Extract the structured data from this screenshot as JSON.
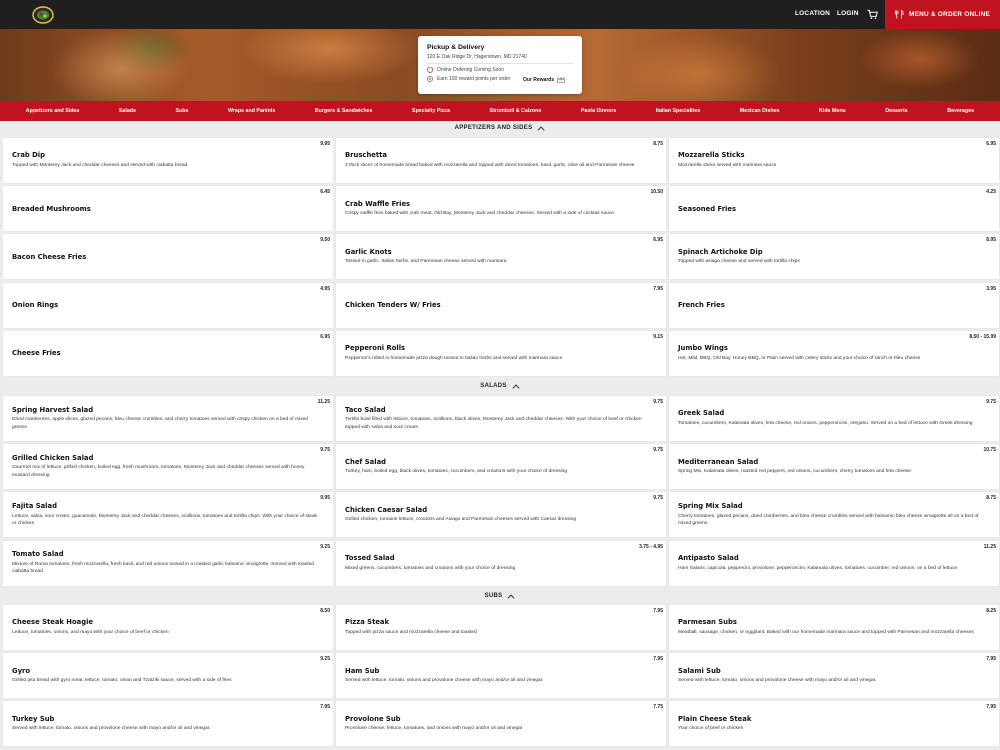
{
  "nav": {
    "location": "LOCATION",
    "login": "LOGIN",
    "order_button": "MENU & ORDER ONLINE"
  },
  "colors": {
    "brand_red": "#c1121f",
    "topbar": "#1f1f1f",
    "card_bg": "#ffffff",
    "page_bg": "#ececec"
  },
  "icons": [
    "logo",
    "cart-icon",
    "utensils-icon",
    "alert-icon",
    "rewards-icon",
    "crown-icon",
    "chevron-up-icon"
  ],
  "pickup": {
    "title": "Pickup & Delivery",
    "address": "120 E Oak Ridge Dr, Hagerstown, MD 21740",
    "notice": "Online Ordering Coming Soon",
    "points": "Earn 100 reward points per order",
    "rewards_link": "Our Rewards"
  },
  "categories": [
    "Appetizers and Sides",
    "Salads",
    "Subs",
    "Wraps and Paninis",
    "Burgers & Sandwiches",
    "Specialty Pizza",
    "Stromboli & Calzone",
    "Pasta Dinners",
    "Italian Specialties",
    "Mexican Dishes",
    "Kids Menu",
    "Desserts",
    "Beverages"
  ],
  "sections": [
    {
      "title": "APPETIZERS AND SIDES",
      "items": [
        {
          "name": "Crab Dip",
          "price": "9.95",
          "desc": "Topped with Monterey Jack and cheddar cheeses and served with ciabatta bread"
        },
        {
          "name": "Bruschetta",
          "price": "8.75",
          "desc": "3 thick slices of homemade bread baked with mozzarella and topped with diced tomatoes, basil, garlic, olive oil and Parmesan cheese"
        },
        {
          "name": "Mozzarella Sticks",
          "price": "6.95",
          "desc": "Mozzarella sticks served with marinara sauce"
        },
        {
          "name": "Breaded Mushrooms",
          "price": "6.45",
          "desc": ""
        },
        {
          "name": "Crab Waffle Fries",
          "price": "10.50",
          "desc": "Crispy waffle fries baked with crab meat, Old Bay, Monterey Jack and cheddar cheeses. Served with a side of cocktail sauce"
        },
        {
          "name": "Seasoned Fries",
          "price": "4.25",
          "desc": ""
        },
        {
          "name": "Bacon Cheese Fries",
          "price": "9.50",
          "desc": ""
        },
        {
          "name": "Garlic Knots",
          "price": "6.95",
          "desc": "Tossed in garlic, Italian herbs, and Parmesan cheese served with marinara"
        },
        {
          "name": "Spinach Artichoke Dip",
          "price": "8.95",
          "desc": "Topped with asiago cheese and served with tortilla chips"
        },
        {
          "name": "Onion Rings",
          "price": "4.95",
          "desc": ""
        },
        {
          "name": "Chicken Tenders W/ Fries",
          "price": "7.95",
          "desc": ""
        },
        {
          "name": "French Fries",
          "price": "3.95",
          "desc": ""
        },
        {
          "name": "Cheese Fries",
          "price": "6.95",
          "desc": ""
        },
        {
          "name": "Pepperoni Rolls",
          "price": "9.15",
          "desc": "Pepperoni's rolled in homemade pizza dough tossed in Italian herbs and served with marinara sauce"
        },
        {
          "name": "Jumbo Wings",
          "price": "8.50 - 15.99",
          "desc": "Hot, Mild, BBQ, Old Bay, Honey BBQ, or Plain served with celery sticks and your choice of ranch or bleu cheese"
        }
      ]
    },
    {
      "title": "SALADS",
      "items": [
        {
          "name": "Spring Harvest Salad",
          "price": "11.25",
          "desc": "Dried cranberries, apple slices, glazed pecans, bleu cheese crumbles, and cherry tomatoes served with crispy chicken on a bed of mixed greens"
        },
        {
          "name": "Taco Salad",
          "price": "9.75",
          "desc": "Tortilla bowl filled with lettuce, tomatoes, scallions, black olives, Monterey Jack and cheddar cheeses. With your choice of beef or chicken topped with salsa and sour cream"
        },
        {
          "name": "Greek Salad",
          "price": "9.75",
          "desc": "Tomatoes, cucumbers, Kalamata olives, feta cheese, red onions, pepperoncini, oregano. Served on a bed of lettuce with Greek dressing"
        },
        {
          "name": "Grilled Chicken Salad",
          "price": "9.75",
          "desc": "Gourmet mix of lettuce, grilled chicken, boiled egg, fresh mushroom, tomatoes, Monterey Jack and cheddar cheeses served with honey mustard dressing"
        },
        {
          "name": "Chef Salad",
          "price": "9.75",
          "desc": "Turkey, ham, boiled egg, black olives, tomatoes, cucumbers, and croutons with your choice of dressing"
        },
        {
          "name": "Mediterranean Salad",
          "price": "10.75",
          "desc": "Spring Mix, Kalamata olives, roasted red peppers, red onions, cucumbers, cherry tomatoes and feta cheese"
        },
        {
          "name": "Fajita Salad",
          "price": "9.95",
          "desc": "Lettuce, salsa, sour cream, guacamole, Monterey Jack and cheddar cheeses, scallions, tomatoes and tortilla chips. With your choice of steak or chicken"
        },
        {
          "name": "Chicken Caesar Salad",
          "price": "9.75",
          "desc": "Grilled chicken, romaine lettuce, croutons and Asiago and Parmesan cheeses served with Caesar dressing"
        },
        {
          "name": "Spring Mix Salad",
          "price": "8.75",
          "desc": "Cherry tomatoes, glazed pecans, dried cranberries, and bleu cheese crumbles served with balsamic-bleu cheese vinaigrette all on a bed of mixed greens"
        },
        {
          "name": "Tomato Salad",
          "price": "9.25",
          "desc": "Mixture of Roma tomatoes, fresh mozzarella, fresh basil, and red onions tossed in a roasted garlic balsamic vinaigrette. Served with toasted ciabatta bread"
        },
        {
          "name": "Tossed Salad",
          "price": "3.75 - 4.95",
          "desc": "Mixed greens, cucumbers, tomatoes and croutons with your choice of dressing"
        },
        {
          "name": "Antipasto Salad",
          "price": "11.25",
          "desc": "Ham Salami, capicola, pepperoni, provolone, pepperoncini, Kalamata olives, tomatoes, cucumber, red onions, on a bed of lettuce"
        }
      ]
    },
    {
      "title": "SUBS",
      "items": [
        {
          "name": "Cheese Steak Hoagie",
          "price": "8.50",
          "desc": "Lettuce, tomatoes, onions, and mayo with your choice of beef or chicken"
        },
        {
          "name": "Pizza Steak",
          "price": "7.95",
          "desc": "Topped with pizza sauce and mozzarella cheese and toasted"
        },
        {
          "name": "Parmesan Subs",
          "price": "8.25",
          "desc": "Meatball, sausage, chicken, or eggplant. Baked with our homemade marinara sauce and topped with Parmesan and mozzarella cheeses"
        },
        {
          "name": "Gyro",
          "price": "9.25",
          "desc": "Grilled pita bread with gyro meat, lettuce, tomato, onion and Tzatziki sauce, served with a side of fries"
        },
        {
          "name": "Ham Sub",
          "price": "7.95",
          "desc": "Served with lettuce, tomato, onions and provolone cheese with mayo and/or oil and vinegar."
        },
        {
          "name": "Salami Sub",
          "price": "7.95",
          "desc": "Served with lettuce, tomato, onions and provolone cheese with mayo and/or oil and vinegar."
        },
        {
          "name": "Turkey Sub",
          "price": "7.95",
          "desc": "Served with lettuce, tomato, onions and provolone cheese with mayo and/or oil and vinegar."
        },
        {
          "name": "Provolone Sub",
          "price": "7.75",
          "desc": "Provolone cheese, lettuce, tomatoes, and onions with mayo and/or oil and vinegar"
        },
        {
          "name": "Plain Cheese Steak",
          "price": "7.95",
          "desc": "Your choice of beef or chicken"
        }
      ]
    }
  ]
}
